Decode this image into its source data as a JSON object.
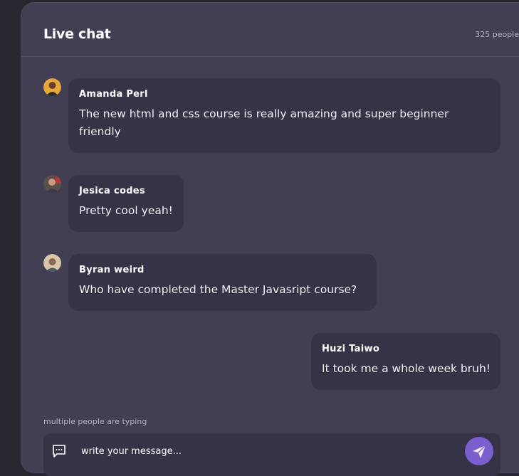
{
  "header": {
    "title": "Live chat",
    "people_count": "325 people"
  },
  "messages": [
    {
      "author": "Amanda Perl",
      "text_line1": "The new html and css course is really amazing and super beginner",
      "text_line2": "friendly",
      "side": "left"
    },
    {
      "author": "Jesica codes",
      "text_line1": "Pretty cool yeah!",
      "side": "left"
    },
    {
      "author": "Byran weird",
      "text_line1": "Who have completed the Master Javasript course?",
      "side": "left"
    },
    {
      "author": "Huzi Taiwo",
      "text_line1": "It took me a whole week bruh!",
      "side": "right"
    }
  ],
  "typing_indicator": "multiple people are typing",
  "composer": {
    "placeholder": "write your message...",
    "icon": "chat-bubble-icon",
    "send_icon": "send-icon"
  },
  "colors": {
    "panel_bg": "#423e53",
    "bubble_bg": "#373346",
    "accent": "#7b5fcf"
  }
}
